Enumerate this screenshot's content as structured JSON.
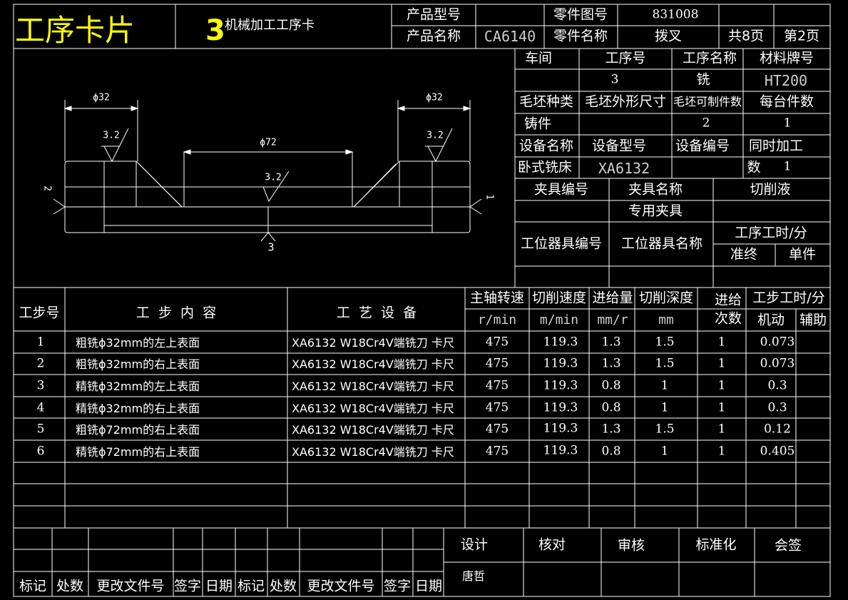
{
  "header": {
    "card_title": "工序卡片",
    "card_number": "3",
    "card_subtitle": "机械加工工序卡",
    "product_model_label": "产品型号",
    "product_model_value": "",
    "part_drawing_label": "零件图号",
    "part_drawing_value": "831008",
    "product_name_label": "产品名称",
    "product_name_value": "CA6140",
    "part_name_label": "零件名称",
    "part_name_value": "拨叉",
    "total_pages": "共8页",
    "page_no": "第2页"
  },
  "info": {
    "workshop_label": "车间",
    "op_no_label": "工序号",
    "op_name_label": "工序名称",
    "material_label": "材料牌号",
    "workshop_value": "",
    "op_no_value": "3",
    "op_name_value": "铣",
    "material_value": "HT200",
    "blank_type_label": "毛坯种类",
    "blank_size_label": "毛坯外形尺寸",
    "blank_parts_label": "毛坯可制件数",
    "per_unit_label": "每台件数",
    "blank_type_value": "铸件",
    "blank_size_value": "",
    "blank_parts_value": "2",
    "per_unit_value": "1",
    "equip_name_label": "设备名称",
    "equip_model_label": "设备型号",
    "equip_no_label": "设备编号",
    "simul_label": "同时加工",
    "equip_name_value": "卧式铣床",
    "equip_model_value": "XA6132",
    "equip_no_value": "",
    "simul_count_label": "数",
    "simul_count_value": "1",
    "fixture_no_label": "夹具编号",
    "fixture_name_label": "夹具名称",
    "coolant_label": "切削液",
    "fixture_name_value": "专用夹具",
    "station_tool_no_label": "工位器具编号",
    "station_tool_name_label": "工位器具名称",
    "op_time_label": "工序工时/分",
    "prep_label": "准终",
    "unit_label": "单件"
  },
  "drawing": {
    "dim_left": "ϕ32",
    "dim_right": "ϕ32",
    "dim_center": "ϕ72",
    "rough_left": "3.2",
    "rough_right": "3.2",
    "rough_center": "3.2",
    "datum_left": "2",
    "datum_right": "1",
    "datum_bottom": "3"
  },
  "steps_table": {
    "headers": {
      "step_no": "工步号",
      "content": "工  步  内  容",
      "equipment": "工  艺  设  备",
      "spindle": "主轴转速",
      "speed": "切削速度",
      "feed": "进给量",
      "depth": "切削深度",
      "passes": "进给次数",
      "time": "工步工时/分",
      "spindle_unit": "r/min",
      "speed_unit": "m/min",
      "feed_unit": "mm/r",
      "depth_unit": "mm",
      "machine_time": "机动",
      "aux_time": "辅助"
    },
    "rows": [
      {
        "no": "1",
        "content": "粗铣ϕ32mm的左上表面",
        "equipment": "XA6132 W18Cr4V端铣刀 卡尺",
        "spindle": "475",
        "speed": "119.3",
        "feed": "1.3",
        "depth": "1.5",
        "passes": "1",
        "machine": "0.073",
        "aux": ""
      },
      {
        "no": "2",
        "content": "粗铣ϕ32mm的右上表面",
        "equipment": "XA6132 W18Cr4V端铣刀 卡尺",
        "spindle": "475",
        "speed": "119.3",
        "feed": "1.3",
        "depth": "1.5",
        "passes": "1",
        "machine": "0.073",
        "aux": ""
      },
      {
        "no": "3",
        "content": "精铣ϕ32mm的左上表面",
        "equipment": "XA6132 W18Cr4V端铣刀 卡尺",
        "spindle": "475",
        "speed": "119.3",
        "feed": "0.8",
        "depth": "1",
        "passes": "1",
        "machine": "0.3",
        "aux": ""
      },
      {
        "no": "4",
        "content": "精铣ϕ32mm的右上表面",
        "equipment": "XA6132 W18Cr4V端铣刀 卡尺",
        "spindle": "475",
        "speed": "119.3",
        "feed": "0.8",
        "depth": "1",
        "passes": "1",
        "machine": "0.3",
        "aux": ""
      },
      {
        "no": "5",
        "content": "粗铣ϕ72mm的右上表面",
        "equipment": "XA6132 W18Cr4V端铣刀 卡尺",
        "spindle": "475",
        "speed": "119.3",
        "feed": "1.3",
        "depth": "1.5",
        "passes": "1",
        "machine": "0.12",
        "aux": ""
      },
      {
        "no": "6",
        "content": "精铣ϕ72mm的右上表面",
        "equipment": "XA6132 W18Cr4V端铣刀 卡尺",
        "spindle": "475",
        "speed": "119.3",
        "feed": "0.8",
        "depth": "1",
        "passes": "1",
        "machine": "0.405",
        "aux": ""
      }
    ]
  },
  "footer": {
    "design_label": "设计",
    "check_label": "核对",
    "review_label": "审核",
    "standard_label": "标准化",
    "countersign_label": "会签",
    "designer": "唐哲",
    "rev_labels": [
      "标记",
      "处数",
      "更改文件号",
      "签字",
      "日期",
      "标记",
      "处数",
      "更改文件号",
      "签字",
      "日期"
    ]
  }
}
